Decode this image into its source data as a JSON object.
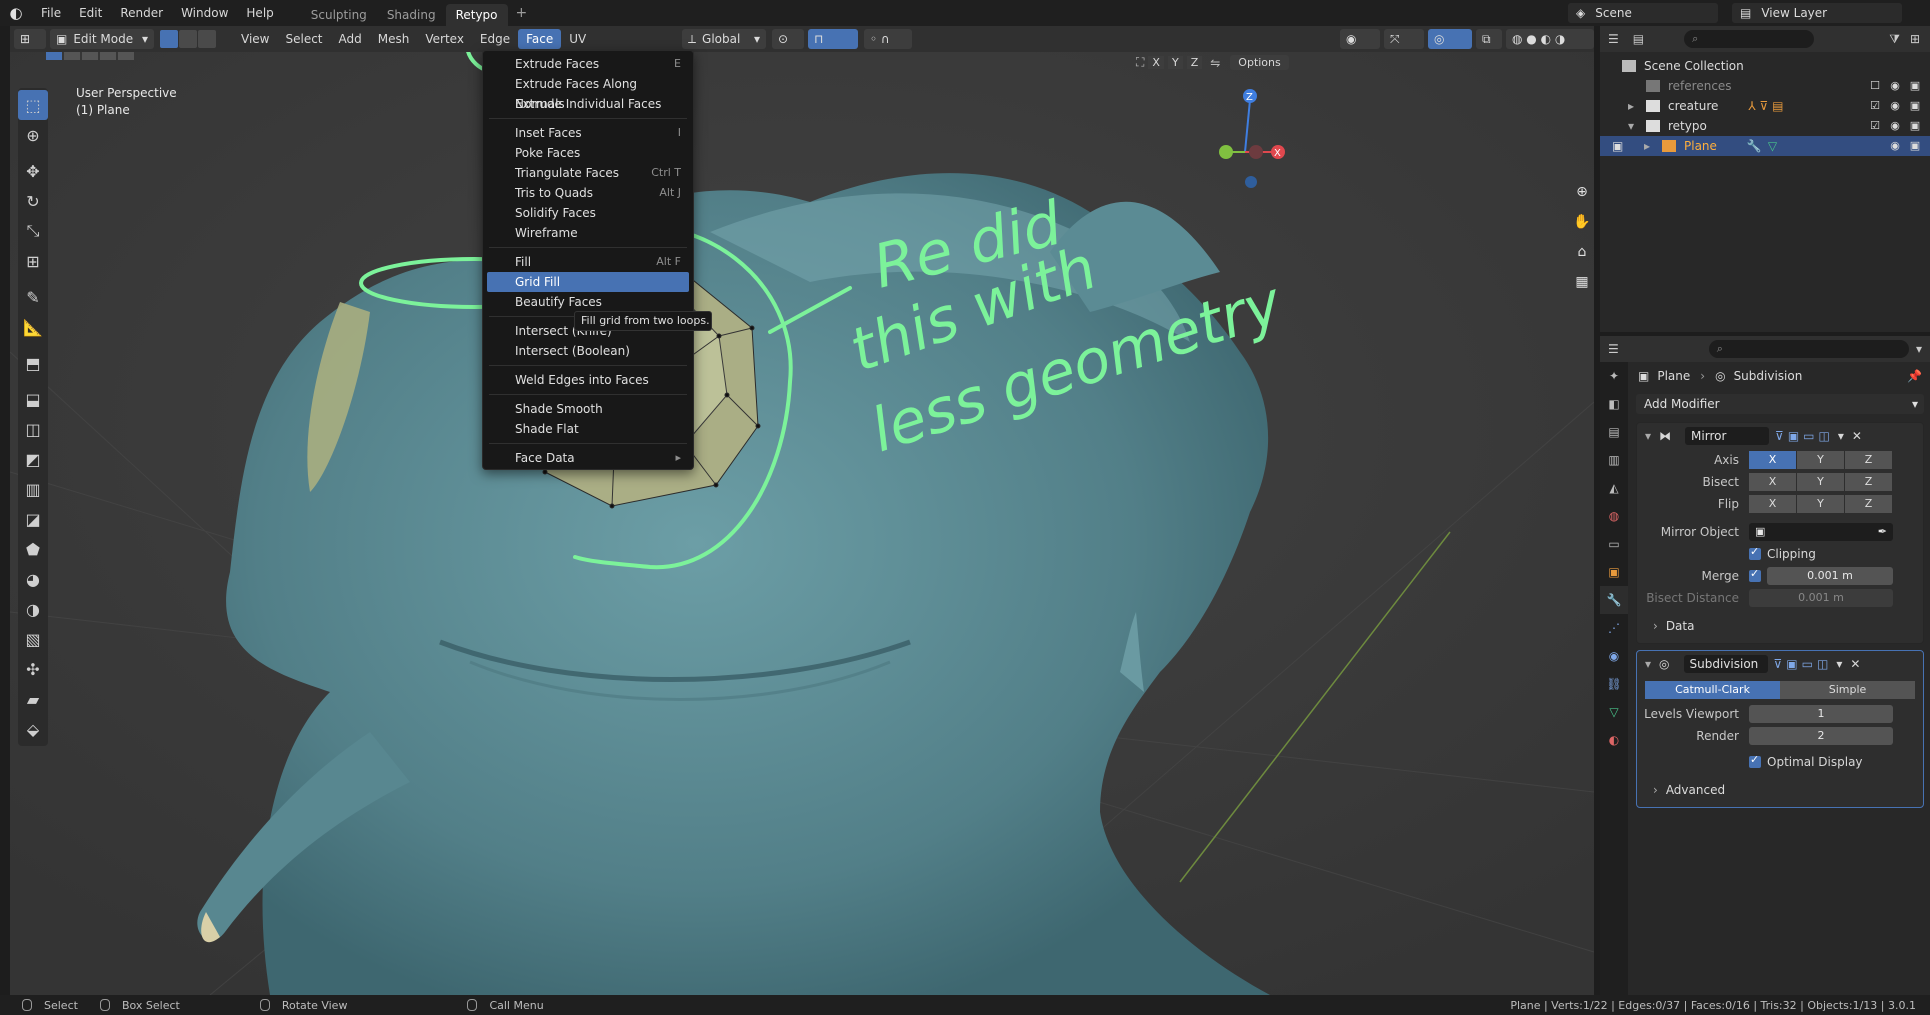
{
  "topbar": {
    "menus": [
      "File",
      "Edit",
      "Render",
      "Window",
      "Help"
    ],
    "workspaces": [
      "Sculpting",
      "Shading",
      "Retypo"
    ],
    "active_workspace": "Retypo",
    "add": "+",
    "scene": "Scene",
    "view_layer": "View Layer"
  },
  "header": {
    "mode": "Edit Mode",
    "menus": [
      "View",
      "Select",
      "Add",
      "Mesh",
      "Vertex",
      "Edge",
      "Face",
      "UV"
    ],
    "active_menu": "Face",
    "orientation": "Global",
    "options": "Options",
    "axes": [
      "X",
      "Y",
      "Z"
    ]
  },
  "viewport": {
    "perspective": "User Perspective",
    "object": "(1) Plane"
  },
  "face_menu": {
    "groups": [
      [
        {
          "label": "Extrude Faces",
          "shortcut": "E"
        },
        {
          "label": "Extrude Faces Along Normals",
          "shortcut": ""
        },
        {
          "label": "Extrude Individual Faces",
          "shortcut": ""
        }
      ],
      [
        {
          "label": "Inset Faces",
          "shortcut": "I"
        },
        {
          "label": "Poke Faces",
          "shortcut": ""
        },
        {
          "label": "Triangulate Faces",
          "shortcut": "Ctrl T"
        },
        {
          "label": "Tris to Quads",
          "shortcut": "Alt J"
        },
        {
          "label": "Solidify Faces",
          "shortcut": ""
        },
        {
          "label": "Wireframe",
          "shortcut": ""
        }
      ],
      [
        {
          "label": "Fill",
          "shortcut": "Alt F"
        },
        {
          "label": "Grid Fill",
          "shortcut": "",
          "highlight": true
        },
        {
          "label": "Beautify Faces",
          "shortcut": ""
        }
      ],
      [
        {
          "label": "Intersect (Knife)",
          "shortcut": ""
        },
        {
          "label": "Intersect (Boolean)",
          "shortcut": ""
        }
      ],
      [
        {
          "label": "Weld Edges into Faces",
          "shortcut": ""
        }
      ],
      [
        {
          "label": "Shade Smooth",
          "shortcut": ""
        },
        {
          "label": "Shade Flat",
          "shortcut": ""
        }
      ],
      [
        {
          "label": "Face Data",
          "shortcut": "▸"
        }
      ]
    ],
    "tooltip": "Fill grid from two loops."
  },
  "annotation": {
    "lines": [
      "Re did",
      "this with",
      "less geometry"
    ],
    "color": "#7cf29a"
  },
  "outliner": {
    "root": "Scene Collection",
    "rows": [
      {
        "name": "references",
        "dim": true
      },
      {
        "name": "creature"
      },
      {
        "name": "retypo"
      },
      {
        "name": "Plane",
        "selected": true
      }
    ]
  },
  "properties": {
    "breadcrumb_object": "Plane",
    "breadcrumb_modifier": "Subdivision",
    "add_modifier": "Add Modifier",
    "mirror": {
      "name": "Mirror",
      "axis_label": "Axis",
      "bisect_label": "Bisect",
      "flip_label": "Flip",
      "axes": [
        "X",
        "Y",
        "Z"
      ],
      "mirror_object_label": "Mirror Object",
      "clipping_label": "Clipping",
      "merge_label": "Merge",
      "merge_value": "0.001 m",
      "bisect_distance_label": "Bisect Distance",
      "bisect_distance_value": "0.001 m",
      "data_label": "Data"
    },
    "subdivision": {
      "name": "Subdivision",
      "type_a": "Catmull-Clark",
      "type_b": "Simple",
      "levels_label": "Levels Viewport",
      "levels_value": "1",
      "render_label": "Render",
      "render_value": "2",
      "optimal_label": "Optimal Display",
      "advanced_label": "Advanced"
    }
  },
  "statusbar": {
    "select": "Select",
    "box_select": "Box Select",
    "rotate": "Rotate View",
    "call_menu": "Call Menu",
    "stats": "Plane | Verts:1/22 | Edges:0/37 | Faces:0/16 | Tris:32 | Objects:1/13 | 3.0.1"
  },
  "colors": {
    "accent": "#4772b3",
    "creature": "#5e8e97",
    "face_fill": "#a8ae80",
    "background": "#3a3a3a"
  }
}
